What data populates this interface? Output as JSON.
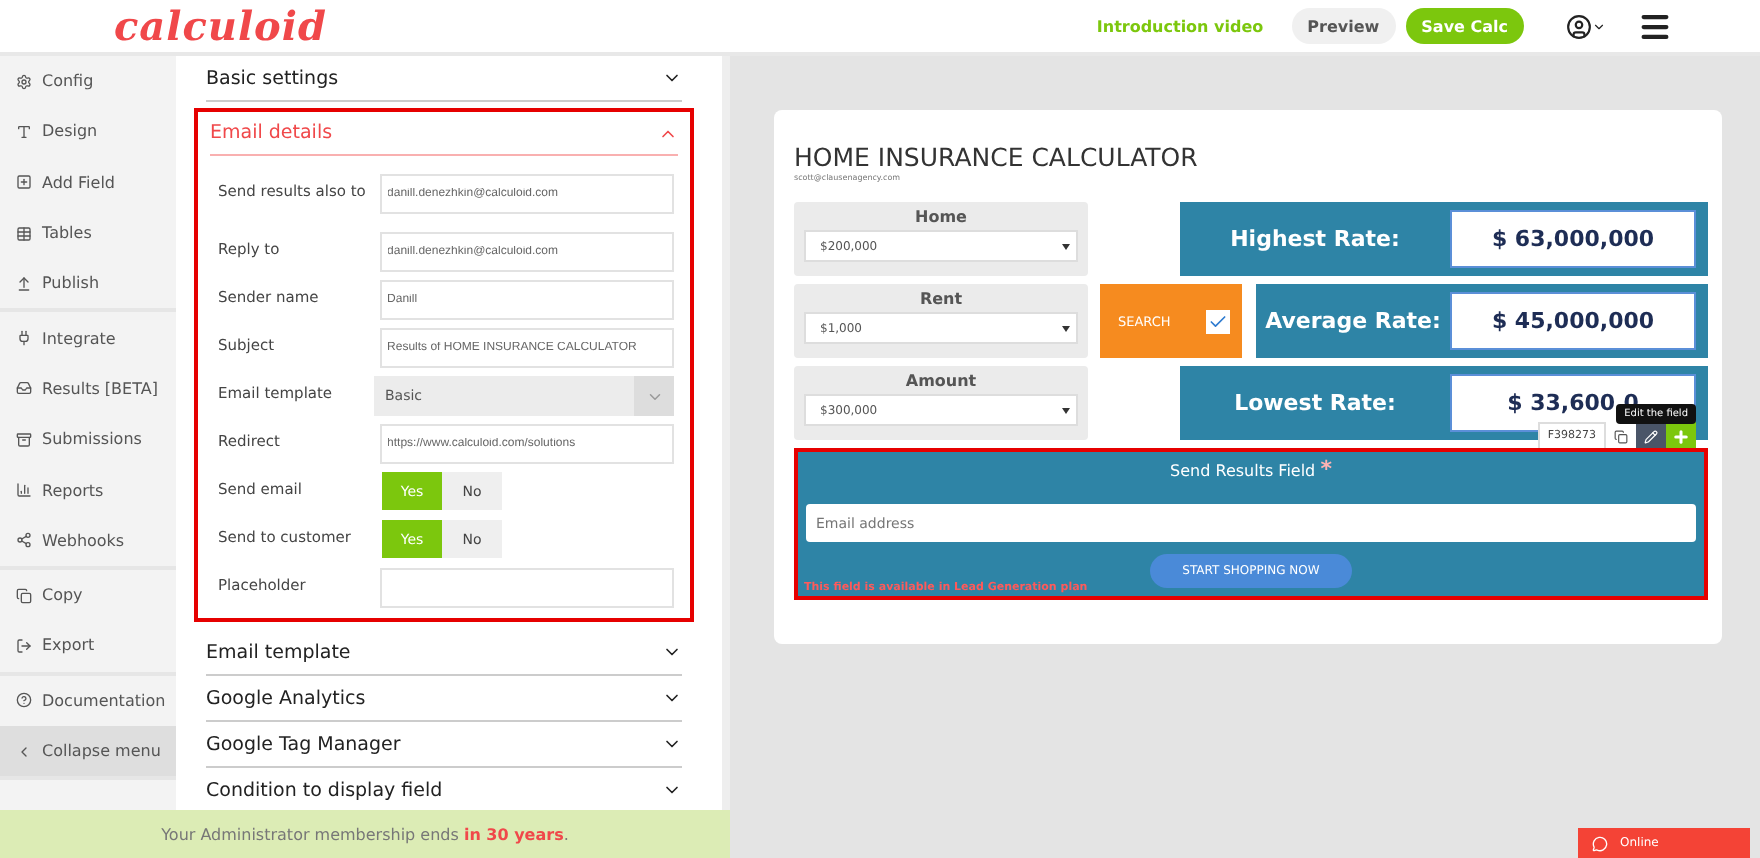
{
  "header": {
    "logo": "calculoid",
    "intro_link": "Introduction video",
    "preview": "Preview",
    "save": "Save Calc"
  },
  "sidebar": {
    "groups": [
      [
        {
          "label": "Config",
          "selected": false
        },
        {
          "label": "Design",
          "selected": false
        },
        {
          "label": "Add Field",
          "selected": false
        },
        {
          "label": "Tables",
          "selected": false
        },
        {
          "label": "Publish",
          "selected": false
        }
      ],
      [
        {
          "label": "Integrate",
          "selected": false
        },
        {
          "label": "Results [BETA]",
          "selected": false
        },
        {
          "label": "Submissions",
          "selected": false
        },
        {
          "label": "Reports",
          "selected": false
        },
        {
          "label": "Webhooks",
          "selected": false
        }
      ],
      [
        {
          "label": "Copy",
          "selected": false
        },
        {
          "label": "Export",
          "selected": false
        }
      ],
      [
        {
          "label": "Documentation",
          "selected": false
        },
        {
          "label": "Collapse menu",
          "selected": true
        }
      ]
    ]
  },
  "settings": {
    "sections": [
      {
        "title": "Basic settings",
        "expanded": false
      },
      {
        "title": "Email details",
        "expanded": true,
        "fields": [
          {
            "kind": "text",
            "label": "Send results also to",
            "value": "danill.denezhkin@calculoid.com"
          },
          {
            "kind": "text",
            "label": "Reply to",
            "value": "danill.denezhkin@calculoid.com"
          },
          {
            "kind": "text",
            "label": "Sender name",
            "value": "Danill"
          },
          {
            "kind": "text",
            "label": "Subject",
            "value": "Results of HOME INSURANCE CALCULATOR"
          },
          {
            "kind": "select",
            "label": "Email template",
            "value": "Basic"
          },
          {
            "kind": "text",
            "label": "Redirect",
            "value": "https://www.calculoid.com/solutions"
          },
          {
            "kind": "toggle",
            "label": "Send email",
            "yes": "Yes",
            "no": "No",
            "on": true
          },
          {
            "kind": "toggle",
            "label": "Send to customer",
            "yes": "Yes",
            "no": "No",
            "on": true
          },
          {
            "kind": "text",
            "label": "Placeholder"
          }
        ]
      },
      {
        "title": "Email template",
        "expanded": false
      },
      {
        "title": "Google Analytics",
        "expanded": false
      },
      {
        "title": "Google Tag Manager",
        "expanded": false
      },
      {
        "title": "Condition to display field",
        "expanded": false
      }
    ]
  },
  "membership": {
    "text": "Your Administrator membership ends ",
    "highlight": "in 30 years",
    "end": "."
  },
  "calculator": {
    "title": "HOME INSURANCE CALCULATOR",
    "email": "scott@clausenagency.com",
    "dropdowns": [
      {
        "label": "Home",
        "value": "$200,000"
      },
      {
        "label": "Rent",
        "value": "$1,000"
      },
      {
        "label": "Amount",
        "value": "$300,000"
      }
    ],
    "search": {
      "label": "SEARCH",
      "checked": true
    },
    "rates": [
      {
        "label": "Highest Rate:",
        "value": "$ 63,000,000"
      },
      {
        "label": "Average Rate:",
        "value": "$ 45,000,000"
      },
      {
        "label": "Lowest Rate:",
        "value": "$ 33,600,0"
      }
    ],
    "field_toolbar": {
      "id": "F398273",
      "tooltip": "Edit the field"
    },
    "send_results": {
      "title": "Send Results Field",
      "required": "*",
      "placeholder": "Email address",
      "button": "START SHOPPING NOW",
      "notice": "This field is available in Lead Generation plan"
    }
  },
  "chat": {
    "label": "Online"
  }
}
